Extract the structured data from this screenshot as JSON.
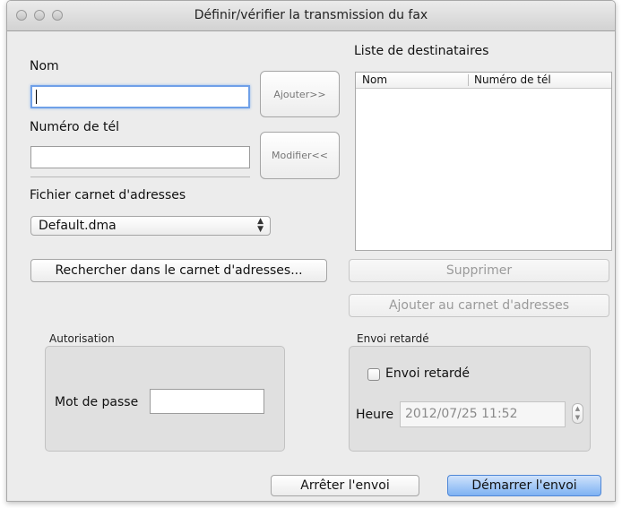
{
  "window": {
    "title": "Définir/vérifier la transmission du fax"
  },
  "left": {
    "name_label": "Nom",
    "name_value": "",
    "phone_label": "Numéro de tél",
    "phone_value": "",
    "add_button": "Ajouter>>",
    "modify_button": "Modifier<<",
    "addressbook_file_label": "Fichier carnet d'adresses",
    "addressbook_file_selected": "Default.dma",
    "search_button": "Rechercher dans le carnet d'adresses..."
  },
  "recipients": {
    "title": "Liste de destinataires",
    "columns": [
      "Nom",
      "Numéro de tél"
    ],
    "rows": [],
    "delete_button": "Supprimer",
    "add_to_book_button": "Ajouter au carnet d'adresses"
  },
  "authorization": {
    "title": "Autorisation",
    "password_label": "Mot de passe",
    "password_value": ""
  },
  "delayed": {
    "title": "Envoi retardé",
    "checkbox_label": "Envoi retardé",
    "checked": false,
    "time_label": "Heure",
    "time_value": "2012/07/25 11:52"
  },
  "footer": {
    "stop_button": "Arrêter l'envoi",
    "start_button": "Démarrer l'envoi"
  },
  "colors": {
    "window_bg": "#ececec",
    "focus_ring": "#6fa0e8",
    "default_button": "#7eb2f3"
  }
}
